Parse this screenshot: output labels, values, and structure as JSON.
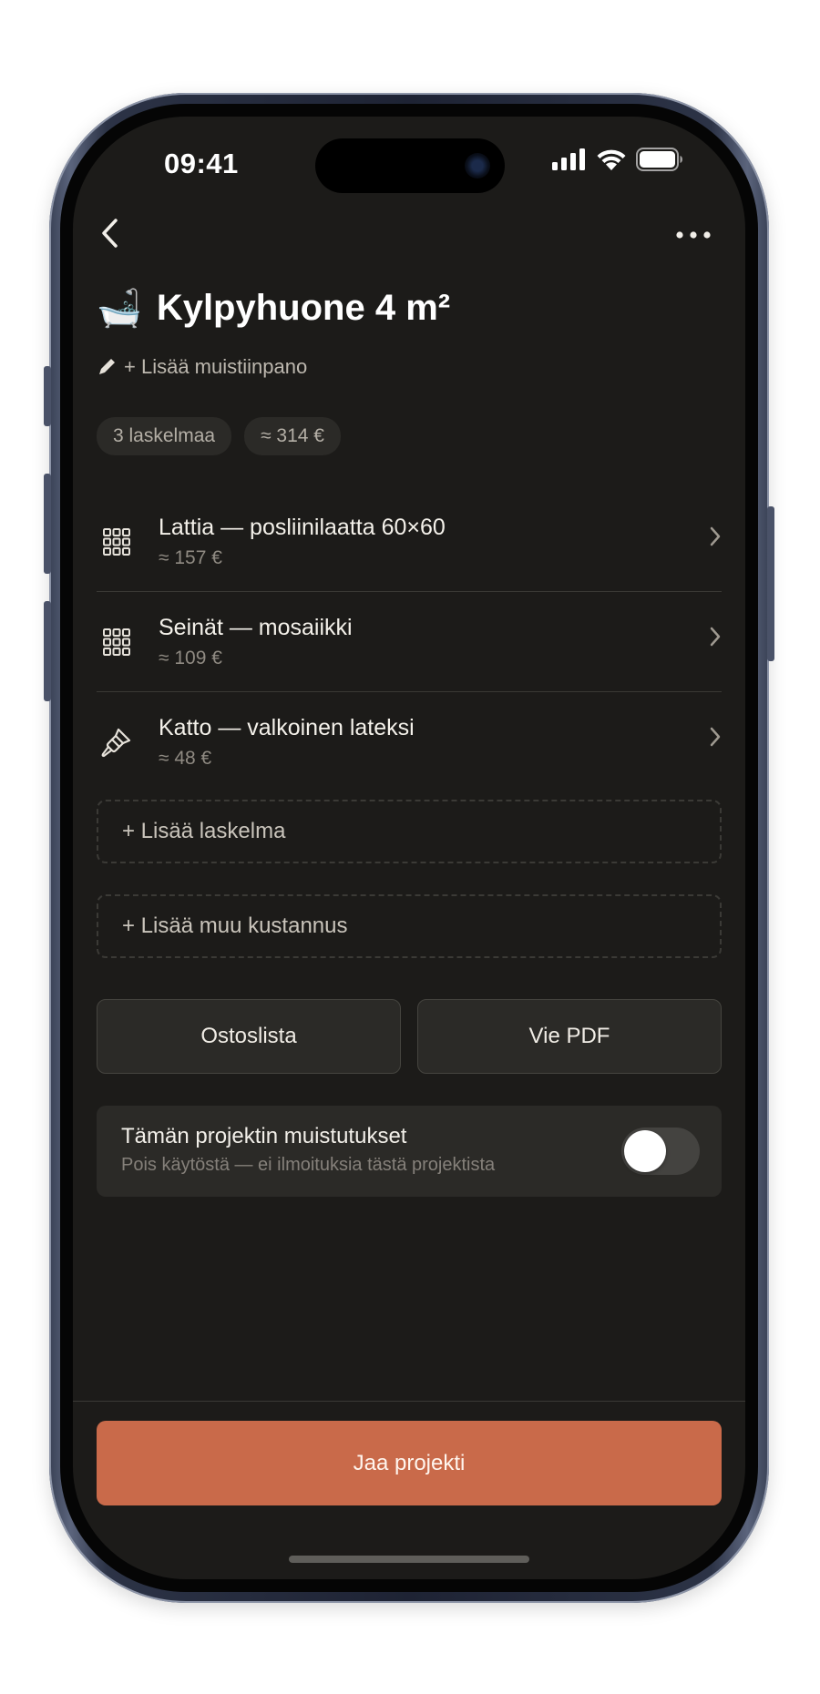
{
  "status_bar": {
    "time": "09:41",
    "icons": [
      "cellular-signal-icon",
      "wifi-icon",
      "battery-icon"
    ]
  },
  "nav": {
    "back_icon": "chevron-left-icon",
    "more_icon": "more-horizontal-icon"
  },
  "project": {
    "emoji": "🛁",
    "title": "Kylpyhuone 4 m²",
    "note_icon": "pencil-icon",
    "note_label": "+ Lisää muistiinpano"
  },
  "chips": {
    "count": "3 laskelmaa",
    "total": "≈ 314 €"
  },
  "calculations": [
    {
      "icon": "tile-grid-icon",
      "title": "Lattia — posliinilaatta 60×60",
      "price": "≈ 157 €"
    },
    {
      "icon": "tile-grid-icon",
      "title": "Seinät — mosaiikki",
      "price": "≈ 109 €"
    },
    {
      "icon": "paintbrush-icon",
      "title": "Katto — valkoinen lateksi",
      "price": "≈ 48 €"
    }
  ],
  "add_buttons": {
    "add_calculation": "+ Lisää laskelma",
    "add_other_cost": "+ Lisää muu kustannus"
  },
  "actions": {
    "shopping_list": "Ostoslista",
    "export_pdf": "Vie PDF"
  },
  "reminders": {
    "title": "Tämän projektin muistutukset",
    "subtitle": "Pois käytöstä — ei ilmoituksia tästä projektista",
    "enabled": false
  },
  "share_button": "Jaa projekti",
  "colors": {
    "background": "#1c1b19",
    "surface": "#2b2a27",
    "accent": "#c96a4a",
    "text_primary": "#f2efe9",
    "text_secondary": "#8f8a82"
  }
}
